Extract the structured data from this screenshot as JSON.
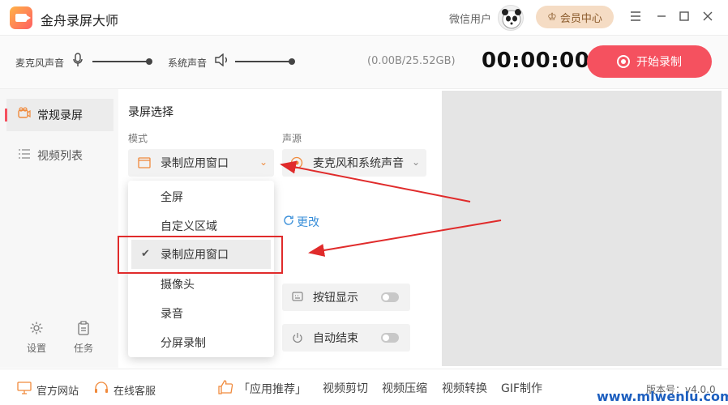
{
  "app": {
    "title": "金舟录屏大师"
  },
  "header": {
    "user_name": "微信用户",
    "vip_label": "会员中心"
  },
  "audio": {
    "mic_label": "麦克风声音",
    "mic_level": 1.0,
    "sys_label": "系统声音",
    "sys_level": 1.0
  },
  "status": {
    "storage": "(0.00B/25.52GB)",
    "timer": "00:00:00",
    "record_label": "开始录制"
  },
  "sidebar": {
    "items": [
      {
        "label": "常规录屏",
        "active": true
      },
      {
        "label": "视频列表",
        "active": false
      }
    ],
    "settings_label": "设置",
    "tasks_label": "任务"
  },
  "main": {
    "section_title": "录屏选择",
    "mode_label": "模式",
    "mode_value": "录制应用窗口",
    "source_label": "声源",
    "source_value": "麦克风和系统声音",
    "change_label": "更改",
    "mode_options": [
      "全屏",
      "自定义区域",
      "录制应用窗口",
      "摄像头",
      "录音",
      "分屏录制"
    ],
    "selected_option_index": 2,
    "toggles": [
      {
        "label": "按钮显示",
        "on": false
      },
      {
        "label": "自动结束",
        "on": false
      }
    ]
  },
  "footer": {
    "website": "官方网站",
    "support": "在线客服",
    "recommend": "「应用推荐」",
    "links": [
      "视频剪切",
      "视频压缩",
      "视频转换",
      "GIF制作"
    ],
    "version": "版本号：v4.0.0"
  },
  "watermark": "www.mlwenlu.com",
  "colors": {
    "accent": "#f5515f",
    "link": "#3a8fd9",
    "annotation": "#e02b2b"
  }
}
